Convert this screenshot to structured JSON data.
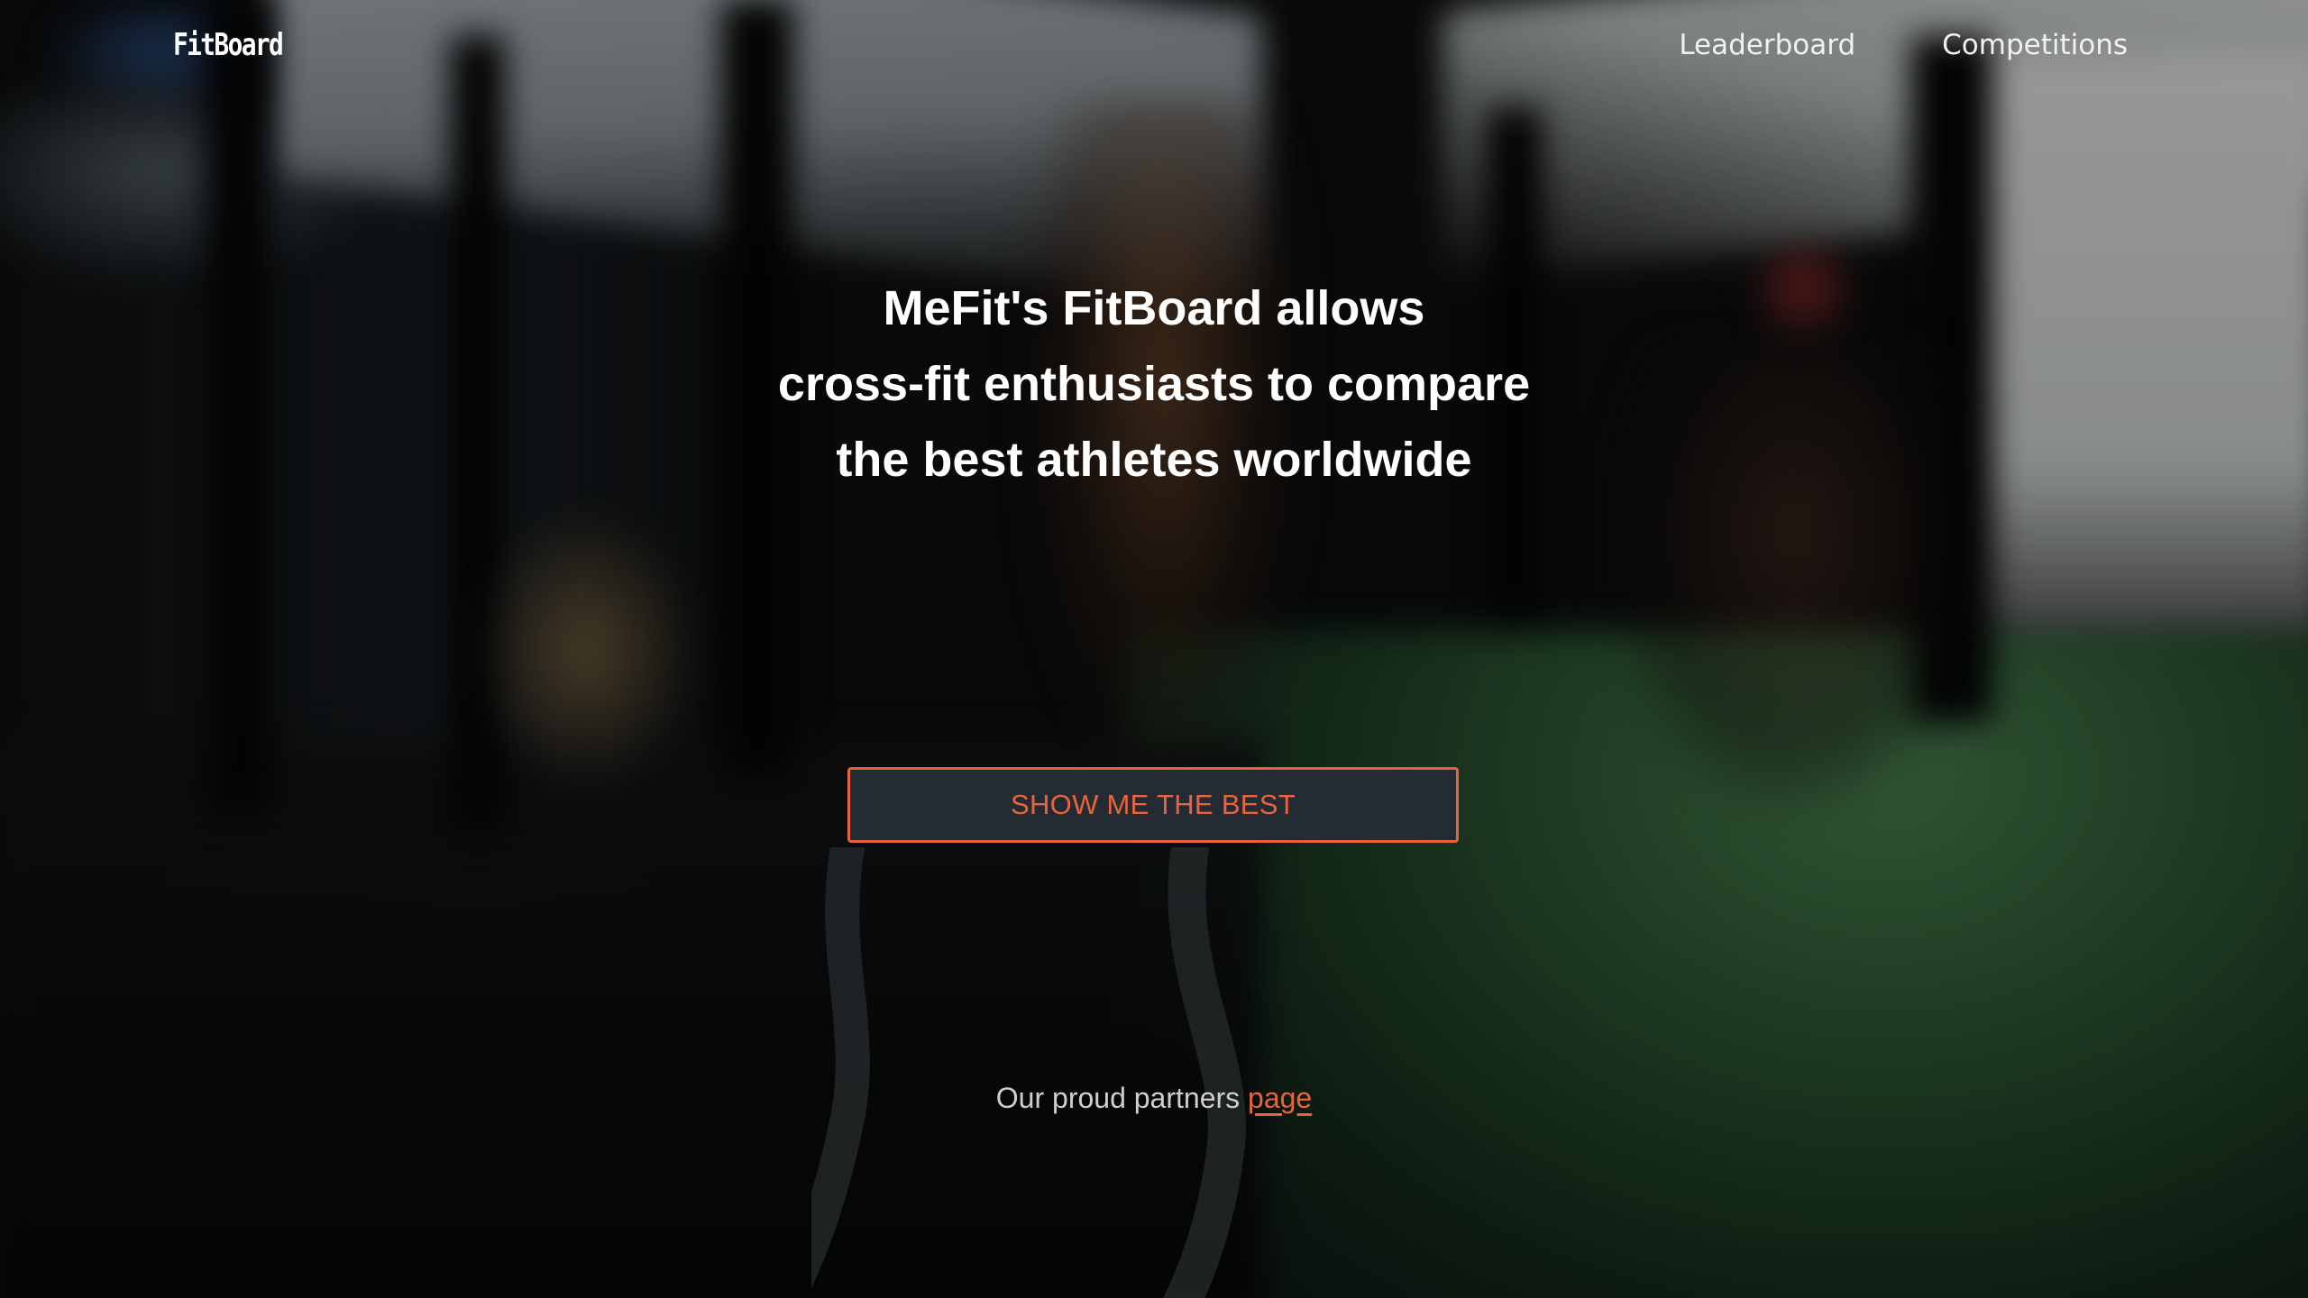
{
  "header": {
    "logo": "FitBoard",
    "nav": [
      {
        "label": "Leaderboard"
      },
      {
        "label": "Competitions"
      }
    ]
  },
  "hero": {
    "lines": [
      "MeFit's FitBoard allows",
      "cross-fit enthusiasts to compare",
      "the best athletes worldwide"
    ],
    "cta_label": "SHOW ME THE BEST"
  },
  "footer": {
    "partners_text": "Our proud partners",
    "partners_link": "page"
  },
  "colors": {
    "accent": "#e8643f",
    "button_bg": "#252b33"
  },
  "background": {
    "icon": "gym-battle-ropes-photo"
  }
}
